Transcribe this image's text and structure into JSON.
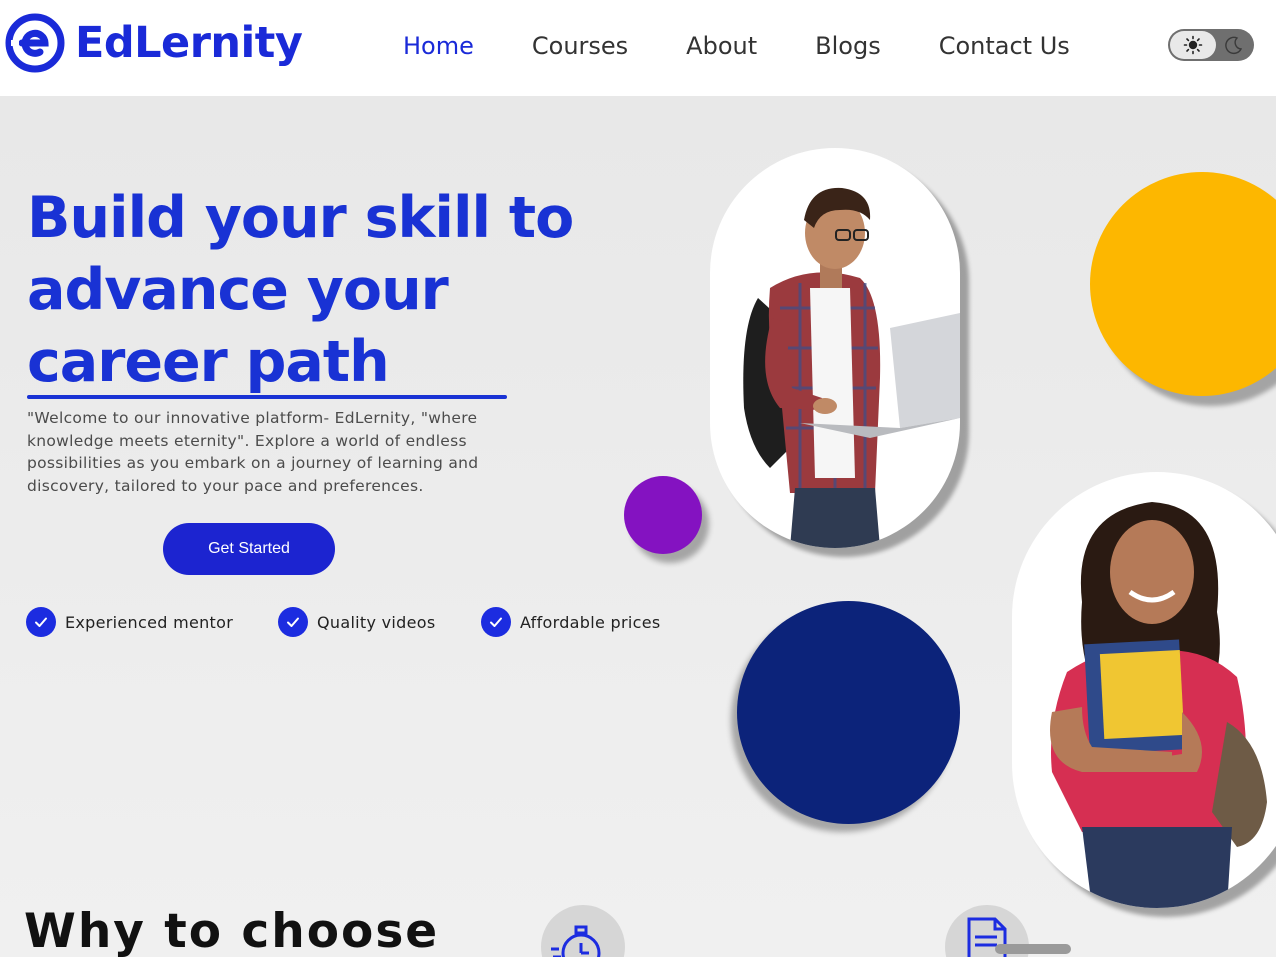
{
  "brand": {
    "name": "EdLernity",
    "color": "#1a2ad8"
  },
  "nav": {
    "items": [
      {
        "label": "Home",
        "active": true
      },
      {
        "label": "Courses"
      },
      {
        "label": "About"
      },
      {
        "label": "Blogs"
      },
      {
        "label": "Contact Us"
      }
    ]
  },
  "theme_toggle": {
    "icons": [
      "sun-icon",
      "moon-icon"
    ],
    "state": "light"
  },
  "hero": {
    "headline_line1": "Build your skill to",
    "headline_line2": "advance your",
    "headline_line3": "career path",
    "intro": "\"Welcome to our innovative platform- EdLernity, \"where knowledge meets eternity\". Explore a world of endless possibilities as you embark on a journey of learning and discovery, tailored to your pace and preferences.",
    "cta_label": "Get Started",
    "features": [
      {
        "label": "Experienced mentor",
        "icon": "check-icon"
      },
      {
        "label": "Quality videos",
        "icon": "check-icon"
      },
      {
        "label": "Affordable prices",
        "icon": "check-icon"
      }
    ]
  },
  "decor_colors": {
    "yellow": "#fdb700",
    "purple": "#8412c1",
    "navy": "#0c237a"
  },
  "why_section": {
    "title": "Why to choose",
    "icons": [
      "stopwatch-icon",
      "document-icon"
    ]
  }
}
